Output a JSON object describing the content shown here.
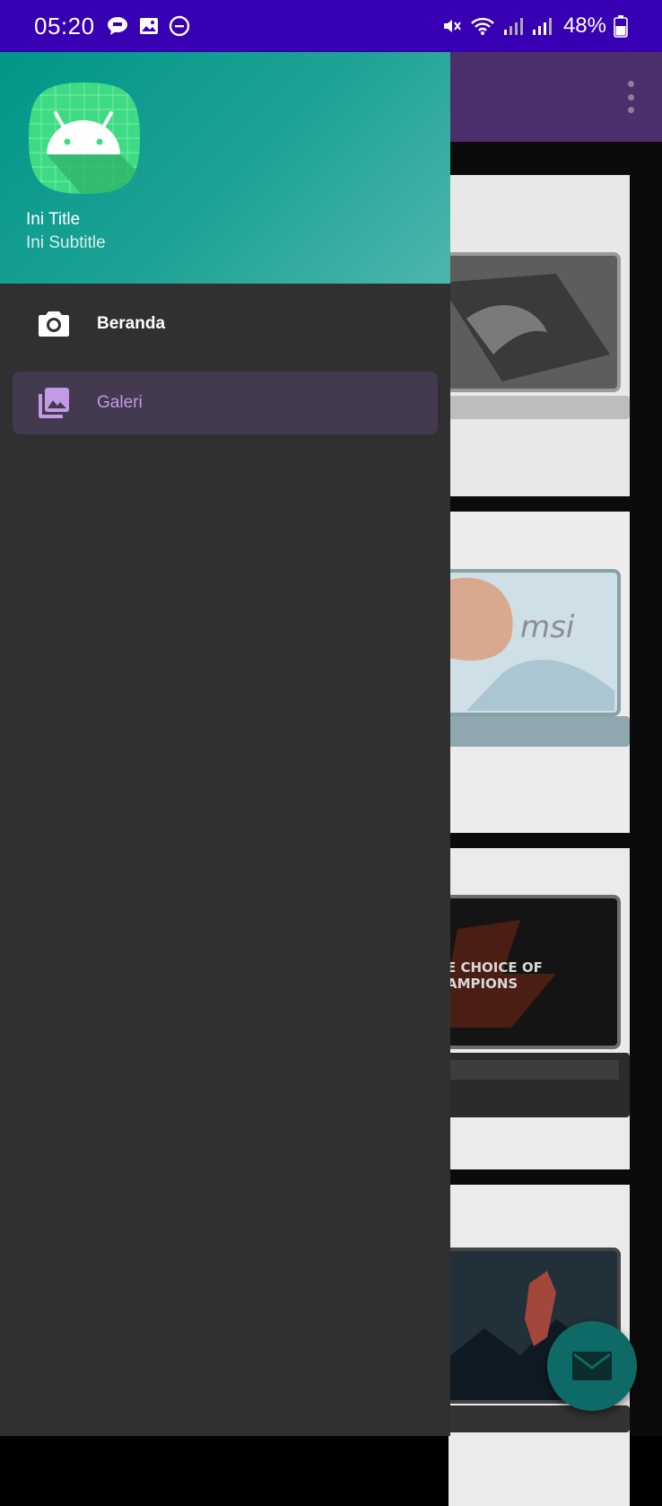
{
  "status_bar": {
    "time": "05:20",
    "battery": "48%",
    "icons": [
      "hey-chat-icon",
      "image-icon",
      "dnd-icon",
      "mute-icon",
      "wifi-icon",
      "signal-icon",
      "signal-icon",
      "battery-icon"
    ]
  },
  "drawer": {
    "header": {
      "title": "Ini Title",
      "subtitle": "Ini Subtitle",
      "logo": "android-icon"
    },
    "items": [
      {
        "label": "Beranda",
        "icon": "camera-icon",
        "selected": false
      },
      {
        "label": "Galeri",
        "icon": "gallery-icon",
        "selected": true
      }
    ]
  },
  "app": {
    "toolbar_menu": "overflow-menu-icon",
    "fab_icon": "mail-icon",
    "cards": [
      "laptop-image",
      "laptop-image",
      "laptop-image",
      "laptop-image"
    ]
  },
  "colors": {
    "status_bar": "#3700b3",
    "drawer_header": "#009688",
    "drawer_bg": "#303030",
    "selected_item_bg": "#433a4f",
    "selected_item_text": "#c39ae6",
    "fab": "#0e6a66"
  }
}
